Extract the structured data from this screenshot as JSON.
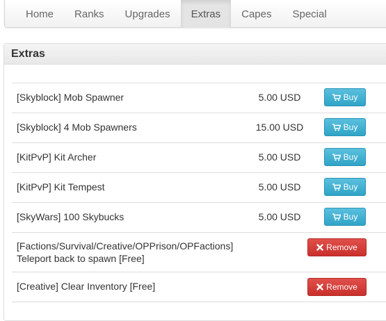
{
  "nav": {
    "items": [
      {
        "label": "Home"
      },
      {
        "label": "Ranks"
      },
      {
        "label": "Upgrades"
      },
      {
        "label": "Extras"
      },
      {
        "label": "Capes"
      },
      {
        "label": "Special"
      }
    ],
    "active": "Extras"
  },
  "panel": {
    "title": "Extras"
  },
  "products": [
    {
      "name": "[Skyblock] Mob Spawner",
      "price": "5.00 USD",
      "action": "Buy",
      "icon": "cart-icon"
    },
    {
      "name": "[Skyblock] 4 Mob Spawners",
      "price": "15.00 USD",
      "action": "Buy",
      "icon": "cart-icon"
    },
    {
      "name": "[KitPvP] Kit Archer",
      "price": "5.00 USD",
      "action": "Buy",
      "icon": "cart-icon"
    },
    {
      "name": "[KitPvP] Kit Tempest",
      "price": "5.00 USD",
      "action": "Buy",
      "icon": "cart-icon"
    },
    {
      "name": "[SkyWars] 100 Skybucks",
      "price": "5.00 USD",
      "action": "Buy",
      "icon": "cart-icon"
    },
    {
      "name": "[Factions/Survival/Creative/OPPrison/OPFactions] Teleport back to spawn [Free]",
      "price": "",
      "action": "Remove",
      "icon": "x-icon"
    },
    {
      "name": "[Creative] Clear Inventory [Free]",
      "price": "",
      "action": "Remove",
      "icon": "x-icon"
    }
  ],
  "colors": {
    "buy": "#3aaed3",
    "remove": "#d9534f"
  }
}
